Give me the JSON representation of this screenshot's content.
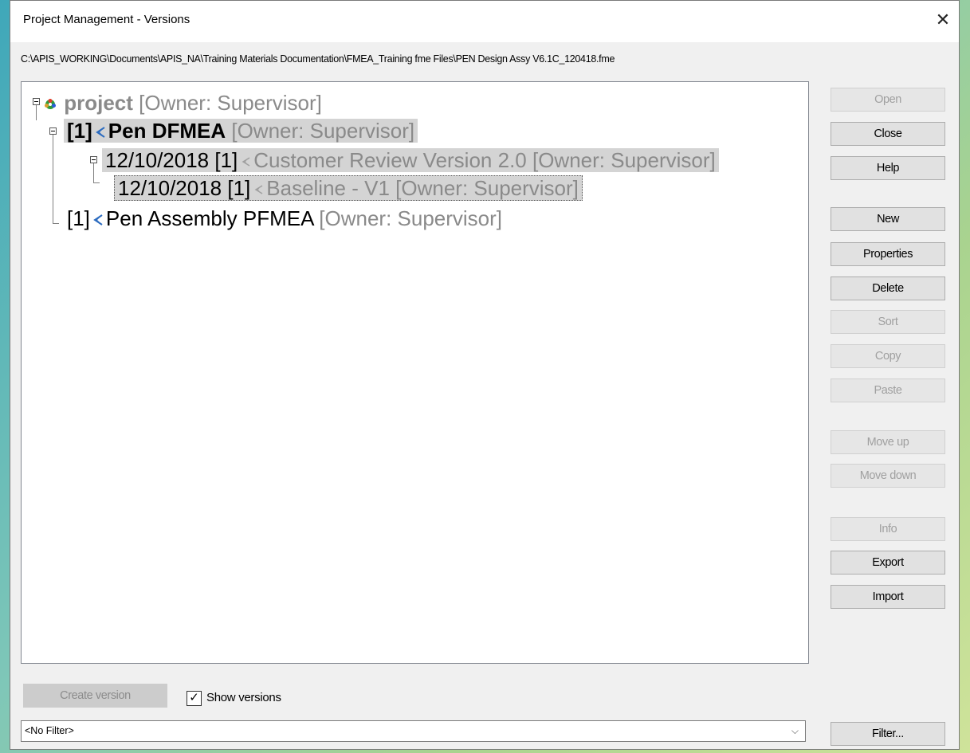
{
  "window": {
    "title": "Project Management - Versions",
    "close_glyph": "✕"
  },
  "path": "C:\\APIS_WORKING\\Documents\\APIS_NA\\Training Materials  Documentation\\FMEA_Training fme Files\\PEN Design  Assy V6.1C_120418.fme",
  "tree": {
    "project": {
      "name": "project",
      "owner": "[Owner: Supervisor]"
    },
    "dfmea": {
      "prefix": "[1]",
      "name": "Pen DFMEA",
      "owner": "[Owner: Supervisor]"
    },
    "customer_review": {
      "prefix": "12/10/2018 [1]",
      "name": "Customer Review Version 2.0",
      "owner": "[Owner: Supervisor]"
    },
    "baseline": {
      "prefix": "12/10/2018 [1]",
      "name": "Baseline - V1",
      "owner": "[Owner: Supervisor]"
    },
    "pfmea": {
      "prefix": "[1]",
      "name": "Pen Assembly PFMEA",
      "owner": "[Owner: Supervisor]"
    }
  },
  "buttons": {
    "open": "Open",
    "close": "Close",
    "help": "Help",
    "new": "New",
    "properties": "Properties",
    "delete": "Delete",
    "sort": "Sort",
    "copy": "Copy",
    "paste": "Paste",
    "move_up": "Move up",
    "move_down": "Move down",
    "info": "Info",
    "export": "Export",
    "import": "Import",
    "filter": "Filter..."
  },
  "bottom": {
    "create_version": "Create version",
    "show_versions_label": "Show versions",
    "show_versions_checked": "✓",
    "filter_value": "<No Filter>",
    "filter_chevron": "⌵"
  },
  "colors": {
    "disabled_text": "#a0a0a0",
    "selection_bg": "#d4d4d4",
    "owner_text": "#8a8a8a"
  }
}
